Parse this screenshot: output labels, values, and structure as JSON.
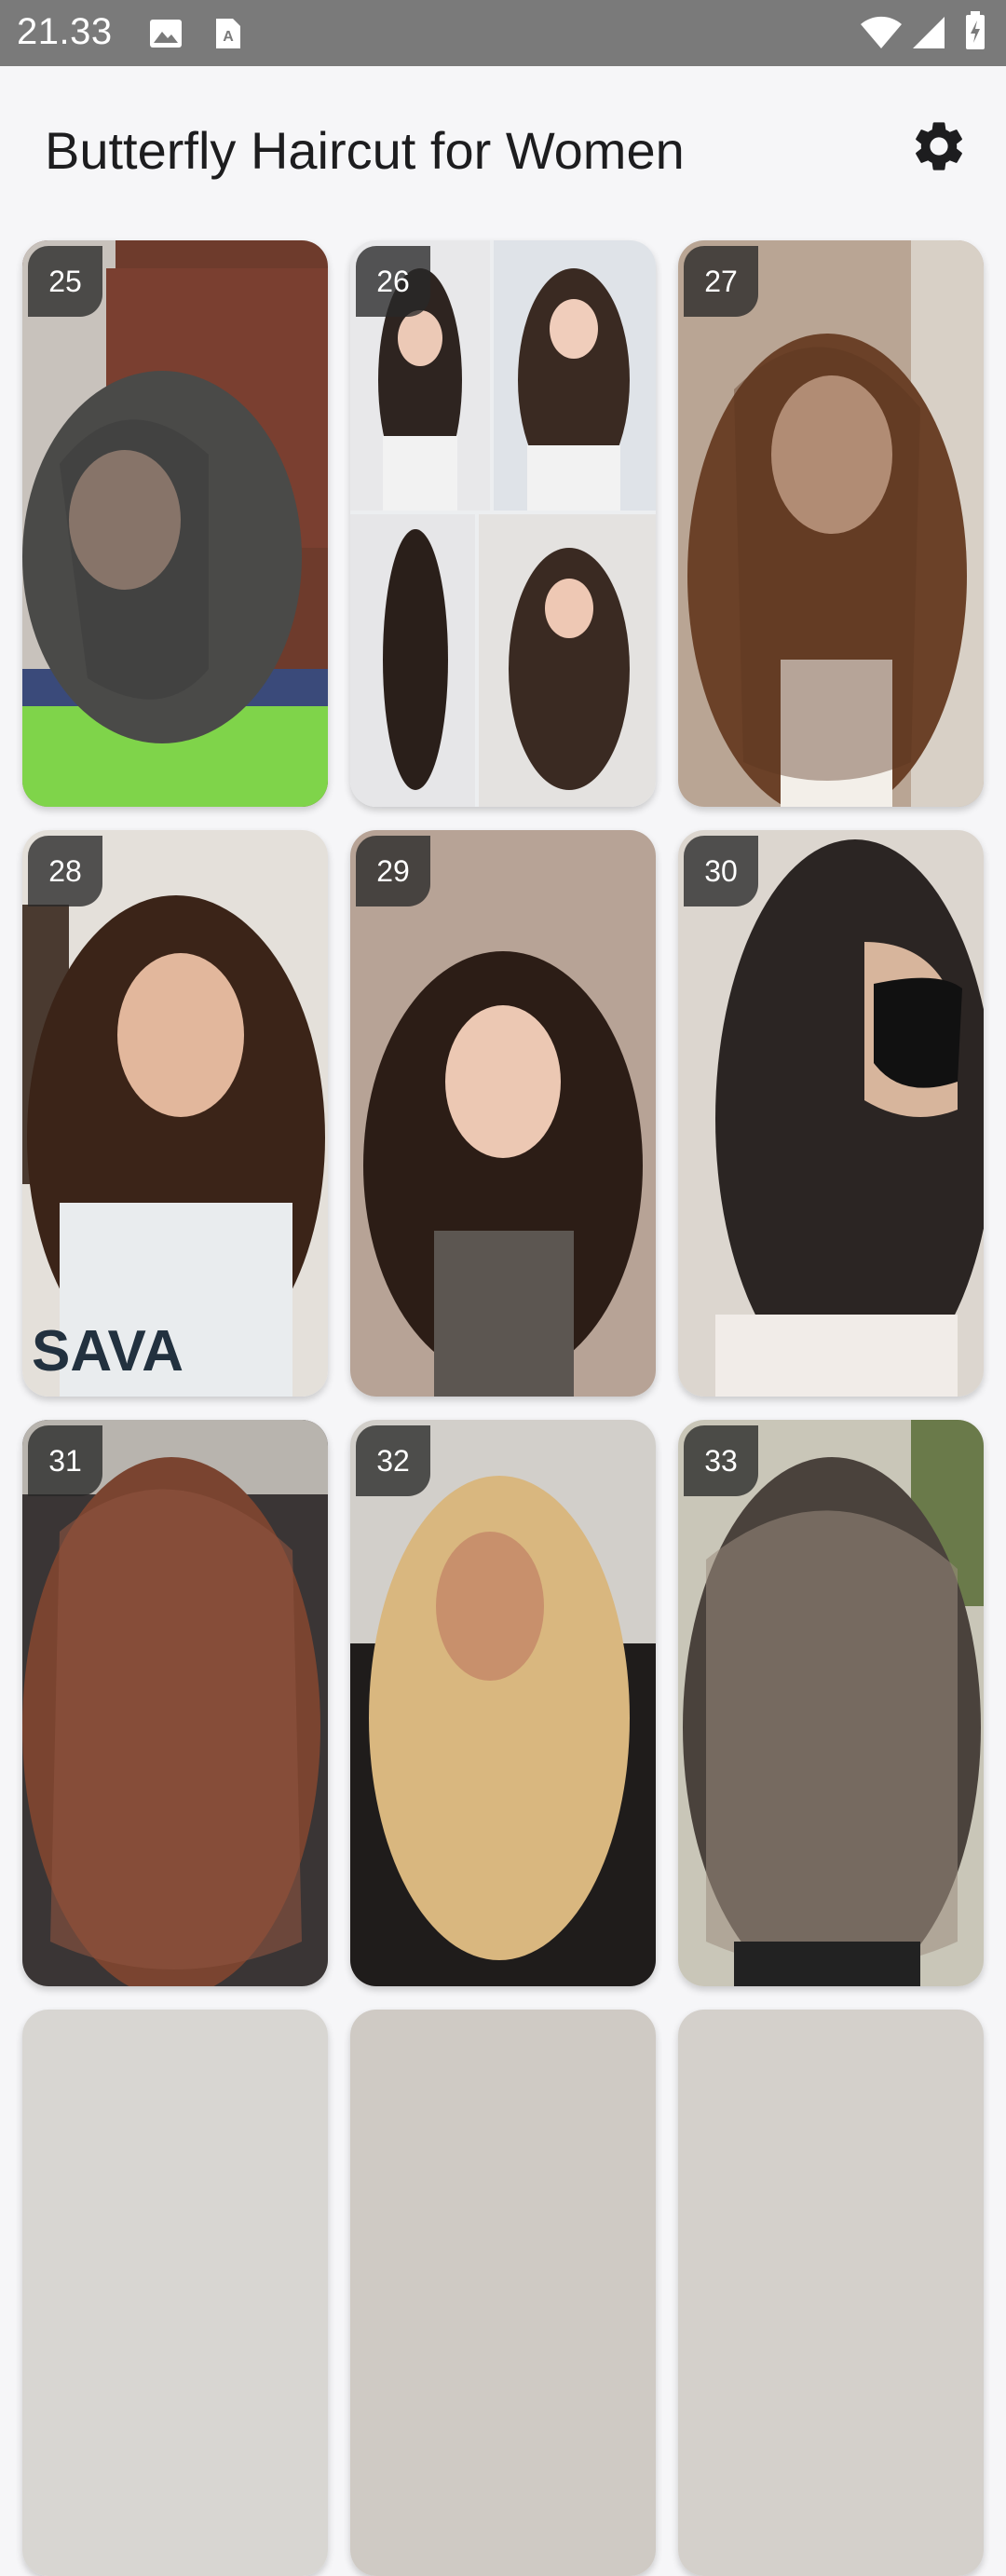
{
  "status_bar": {
    "time": "21.33",
    "icons": [
      "image-icon",
      "font-icon",
      "wifi-icon",
      "signal-icon",
      "battery-charging-icon"
    ]
  },
  "app_bar": {
    "title": "Butterfly Haircut for Women",
    "settings_icon": "gear-icon"
  },
  "gallery": {
    "items": [
      {
        "number": "25"
      },
      {
        "number": "26"
      },
      {
        "number": "27"
      },
      {
        "number": "28"
      },
      {
        "number": "29"
      },
      {
        "number": "30"
      },
      {
        "number": "31"
      },
      {
        "number": "32"
      },
      {
        "number": "33"
      }
    ]
  }
}
